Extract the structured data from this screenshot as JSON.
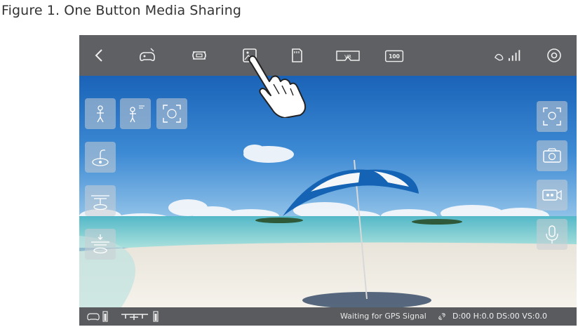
{
  "caption": "Figure 1. One Button Media Sharing",
  "topbar": {
    "icons": [
      "back-chevron-icon",
      "flight-controller-icon",
      "drone-frame-icon",
      "gallery-icon",
      "sd-card-icon",
      "vr-icon",
      "speed-100-icon",
      "signal-strength-icon",
      "settings-gear-icon"
    ],
    "speed_label": "100",
    "vr_label": "VR"
  },
  "left_controls": [
    "takeoff-person-icon",
    "takeoff-fast-icon",
    "face-track-icon",
    "gimbal-follow-icon",
    "propeller-mode-icon",
    "landing-mode-icon"
  ],
  "right_controls": [
    "face-recognition-icon",
    "camera-photo-icon",
    "video-record-icon",
    "microphone-icon"
  ],
  "bottombar": {
    "status_text": "Waiting for GPS Signal",
    "telemetry": "D:00 H:0.0 DS:00 VS:0.0"
  },
  "colors": {
    "topbar": "#5f6063",
    "bottombar": "#5a5b5e",
    "overlay": "#c8cdd4"
  }
}
